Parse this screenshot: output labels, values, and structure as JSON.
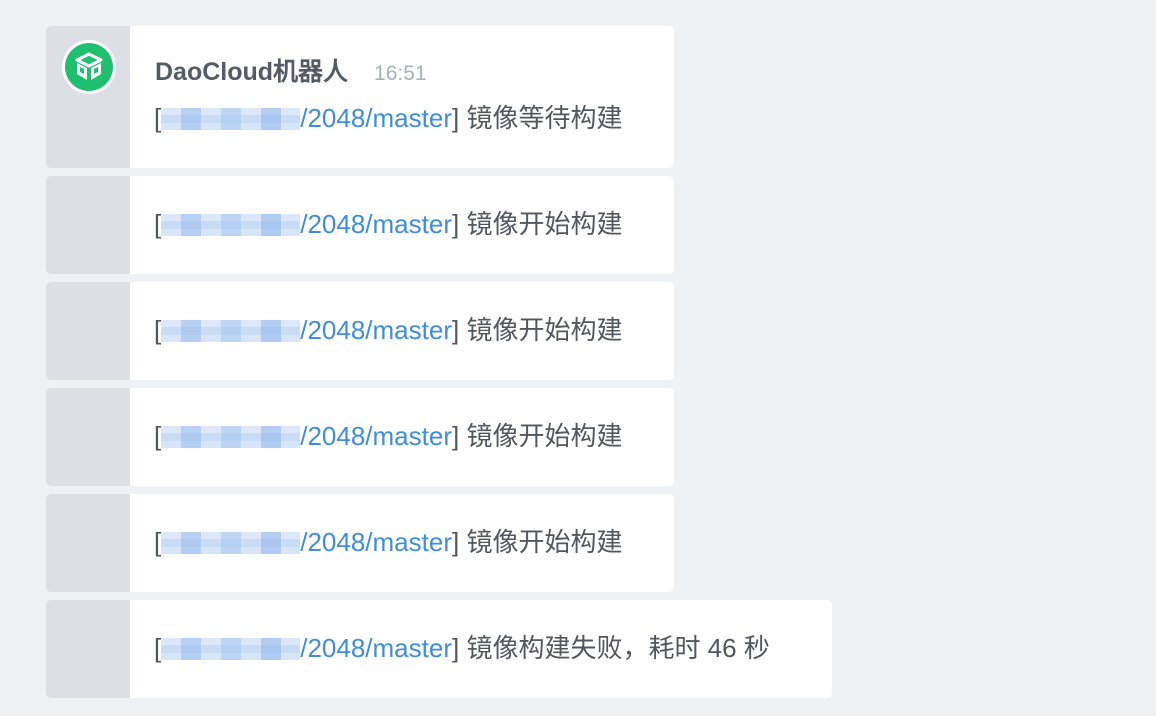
{
  "colors": {
    "background": "#eef2f5",
    "card": "#ffffff",
    "gutter": "#dcdfe3",
    "avatar_green": "#1fbf70",
    "sender_text": "#545b66",
    "time_text": "#a9b0b9",
    "body_text": "#52575f",
    "link": "#3f8ddb"
  },
  "header": {
    "sender": "DaoCloud机器人",
    "time": "16:51",
    "avatar_icon": "daocloud-logo-icon"
  },
  "messages": [
    {
      "open": "[",
      "link": "/2048/master",
      "close": "]",
      "status": " 镜像等待构建"
    },
    {
      "open": "[",
      "link": "/2048/master",
      "close": "]",
      "status": " 镜像开始构建"
    },
    {
      "open": "[",
      "link": "/2048/master",
      "close": "]",
      "status": " 镜像开始构建"
    },
    {
      "open": "[",
      "link": "/2048/master",
      "close": "]",
      "status": " 镜像开始构建"
    },
    {
      "open": "[",
      "link": "/2048/master",
      "close": "]",
      "status": " 镜像开始构建"
    },
    {
      "open": "[",
      "link": "/2048/master",
      "close": "]",
      "status": " 镜像构建失败，耗时 46 秒"
    }
  ]
}
